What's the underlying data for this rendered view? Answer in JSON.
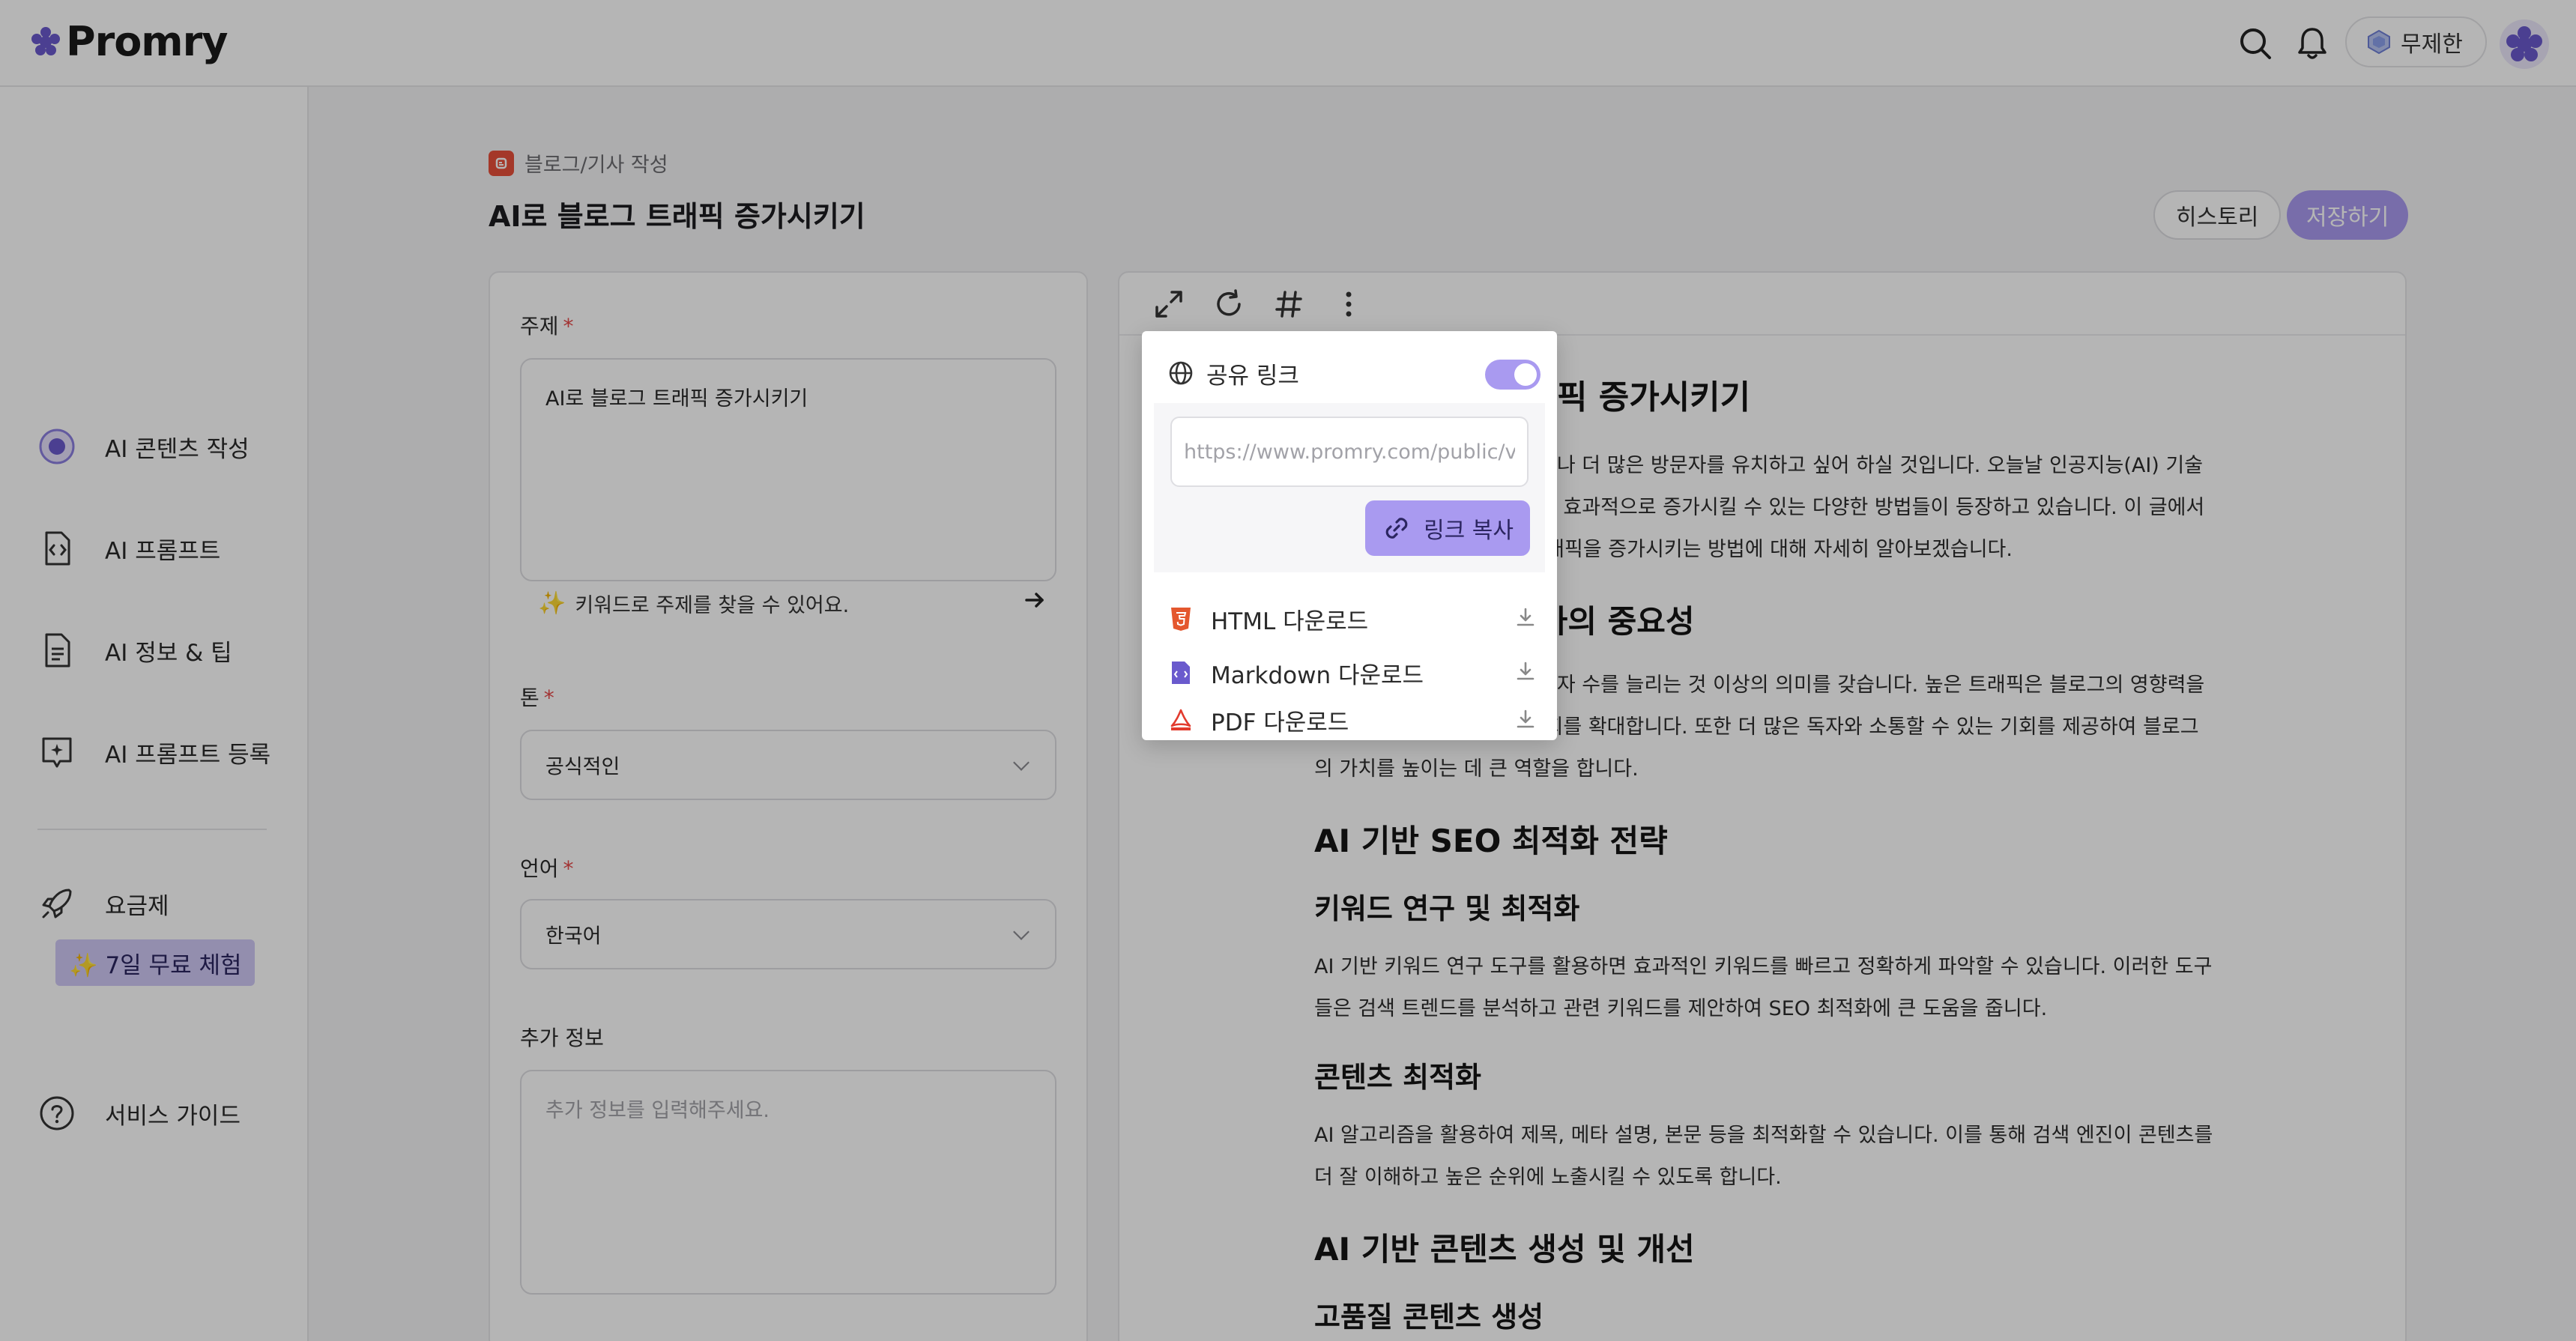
{
  "header": {
    "logo_text": "Promry",
    "plan_label": "무제한",
    "icons": [
      "search-icon",
      "bell-icon",
      "plan-icon",
      "avatar"
    ]
  },
  "sidebar": {
    "items": [
      {
        "label": "AI 콘텐츠 작성",
        "icon": "content-icon"
      },
      {
        "label": "AI 프롬프트",
        "icon": "prompt-file-icon"
      },
      {
        "label": "AI 정보 & 팁",
        "icon": "document-icon"
      },
      {
        "label": "AI 프롬프트 등록",
        "icon": "register-prompt-icon"
      },
      {
        "label": "요금제",
        "icon": "rocket-icon"
      },
      {
        "label": "서비스 가이드",
        "icon": "help-icon"
      }
    ],
    "trial_badge": "✨ 7일 무료 체험"
  },
  "breadcrumb": {
    "category": "블로그/기사 작성"
  },
  "page_title": "AI로 블로그 트래픽 증가시키기",
  "actions": {
    "history": "히스토리",
    "save": "저장하기"
  },
  "form": {
    "topic_label": "주제",
    "topic_value": "AI로 블로그 트래픽 증가시키기",
    "keyword_hint": "키워드로 주제를 찾을 수 있어요.",
    "tone_label": "톤",
    "tone_value": "공식적인",
    "language_label": "언어",
    "language_value": "한국어",
    "extra_label": "추가 정보",
    "extra_placeholder": "추가 정보를 입력해주세요.",
    "required_mark": "*"
  },
  "document": {
    "h1": "AI로 블로그 트래픽 증가시키기",
    "p1": "블로그를 운영하다 보면 누구나 더 많은 방문자를 유치하고 싶어 하실 것입니다. 오늘날 인공지능(AI) 기술의 발전으로 블로그 트래픽을 효과적으로 증가시킬 수 있는 다양한 방법들이 등장하고 있습니다. 이 글에서는 AI를 활용하여 블로그 트래픽을 증가시키는 방법에 대해 자세히 알아보겠습니다.",
    "h2a": "블로그 트래픽 증가의 중요성",
    "p2": "블로그 트래픽은 단순히 방문자 수를 늘리는 것 이상의 의미를 갖습니다. 높은 트래픽은 블로그의 영향력을 증대시키고, 수익 창출의 기회를 확대합니다. 또한 더 많은 독자와 소통할 수 있는 기회를 제공하여 블로그의 가치를 높이는 데 큰 역할을 합니다.",
    "h2b": "AI 기반 SEO 최적화 전략",
    "h3a": "키워드 연구 및 최적화",
    "p3": "AI 기반 키워드 연구 도구를 활용하면 효과적인 키워드를 빠르고 정확하게 파악할 수 있습니다. 이러한 도구들은 검색 트렌드를 분석하고 관련 키워드를 제안하여 SEO 최적화에 큰 도움을 줍니다.",
    "h3b": "콘텐츠 최적화",
    "p4": "AI 알고리즘을 활용하여 제목, 메타 설명, 본문 등을 최적화할 수 있습니다. 이를 통해 검색 엔진이 콘텐츠를 더 잘 이해하고 높은 순위에 노출시킬 수 있도록 합니다.",
    "h2c": "AI 기반 콘텐츠 생성 및 개선",
    "h3c": "고품질 콘텐츠 생성"
  },
  "share_popover": {
    "share_label": "공유 링크",
    "share_enabled": true,
    "url_value": "https://www.promry.com/public/v",
    "copy_label": "링크 복사",
    "downloads": [
      {
        "label": "HTML 다운로드",
        "icon": "html5-icon"
      },
      {
        "label": "Markdown 다운로드",
        "icon": "markdown-file-icon"
      },
      {
        "label": "PDF 다운로드",
        "icon": "pdf-icon"
      }
    ]
  },
  "colors": {
    "accent": "#a99af0",
    "accent_text": "#2b2560",
    "required": "#e54848",
    "blog_icon": "#e8503a"
  }
}
